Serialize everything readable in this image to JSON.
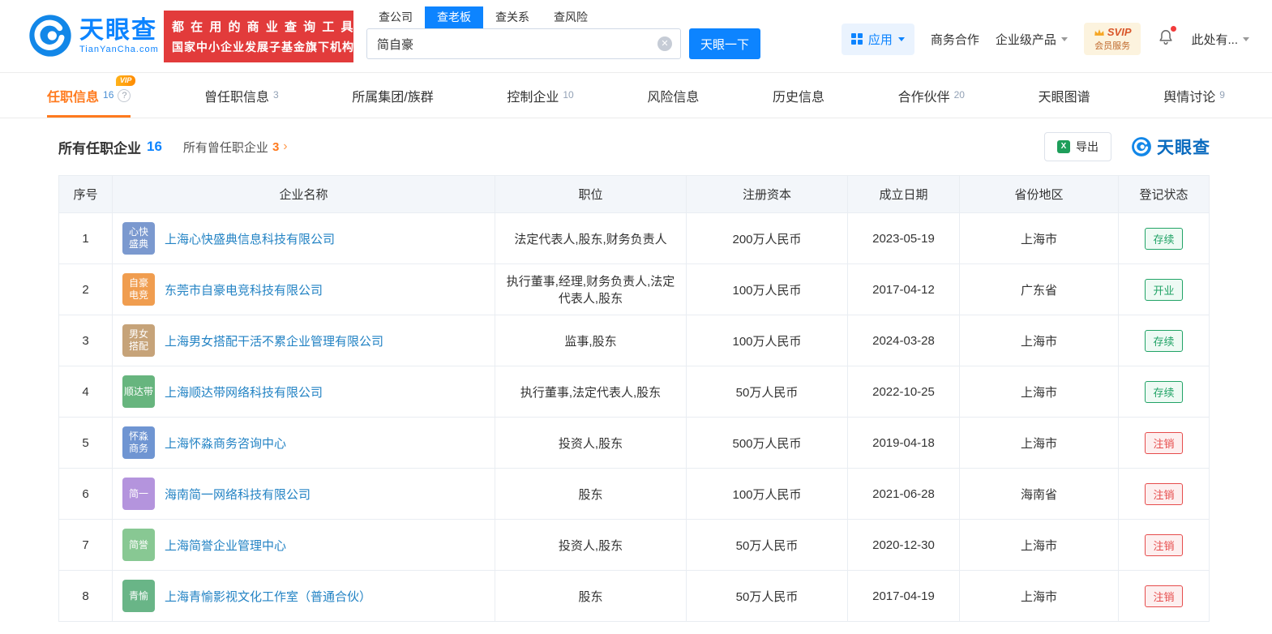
{
  "icons": {
    "help": "?",
    "clear": "✕",
    "chevron": "›",
    "excel": "X"
  },
  "header": {
    "logo": {
      "name": "天眼查",
      "domain": "TianYanCha.com"
    },
    "banner": {
      "line1": "都 在 用 的 商 业 查 询 工 具",
      "line2": "国家中小企业发展子基金旗下机构"
    },
    "search": {
      "tabs": [
        {
          "label": "查公司"
        },
        {
          "label": "查老板"
        },
        {
          "label": "查关系"
        },
        {
          "label": "查风险"
        }
      ],
      "value": "简自豪",
      "button": "天眼一下"
    },
    "nav": {
      "apps": "应用",
      "coop": "商务合作",
      "enterprise": "企业级产品",
      "svip_line1": "SVIP",
      "svip_line2": "会员服务",
      "user": "此处有..."
    }
  },
  "tabs": [
    {
      "label": "任职信息",
      "count": "16",
      "vip": "VIP"
    },
    {
      "label": "曾任职信息",
      "count": "3"
    },
    {
      "label": "所属集团/族群",
      "count": ""
    },
    {
      "label": "控制企业",
      "count": "10"
    },
    {
      "label": "风险信息",
      "count": ""
    },
    {
      "label": "历史信息",
      "count": ""
    },
    {
      "label": "合作伙伴",
      "count": "20"
    },
    {
      "label": "天眼图谱",
      "count": ""
    },
    {
      "label": "舆情讨论",
      "count": "9"
    }
  ],
  "section": {
    "title": "所有任职企业",
    "count": "16",
    "subtitle": "所有曾任职企业",
    "subcount": "3",
    "export_label": "导出",
    "brand": "天眼查"
  },
  "table": {
    "headers": [
      "序号",
      "企业名称",
      "职位",
      "注册资本",
      "成立日期",
      "省份地区",
      "登记状态"
    ],
    "rows": [
      {
        "seq": "1",
        "icon_line1": "心快",
        "icon_line2": "盛典",
        "icon_color": "#7b99cf",
        "name": "上海心快盛典信息科技有限公司",
        "position": "法定代表人,股东,财务负责人",
        "capital": "200万人民币",
        "date": "2023-05-19",
        "province": "上海市",
        "status": "存续",
        "status_color": "#21a366",
        "status_bg": "#eefaf4"
      },
      {
        "seq": "2",
        "icon_line1": "自豪",
        "icon_line2": "电竞",
        "icon_color": "#f09d4f",
        "name": "东莞市自豪电竞科技有限公司",
        "position": "执行董事,经理,财务负责人,法定代表人,股东",
        "capital": "100万人民币",
        "date": "2017-04-12",
        "province": "广东省",
        "status": "开业",
        "status_color": "#21a366",
        "status_bg": "#eefaf4"
      },
      {
        "seq": "3",
        "icon_line1": "男女",
        "icon_line2": "搭配",
        "icon_color": "#c6a379",
        "name": "上海男女搭配干活不累企业管理有限公司",
        "position": "监事,股东",
        "capital": "100万人民币",
        "date": "2024-03-28",
        "province": "上海市",
        "status": "存续",
        "status_color": "#21a366",
        "status_bg": "#eefaf4"
      },
      {
        "seq": "4",
        "icon_line1": "顺达带",
        "icon_line2": "",
        "icon_color": "#67b57e",
        "name": "上海顺达带网络科技有限公司",
        "position": "执行董事,法定代表人,股东",
        "capital": "50万人民币",
        "date": "2022-10-25",
        "province": "上海市",
        "status": "存续",
        "status_color": "#21a366",
        "status_bg": "#eefaf4"
      },
      {
        "seq": "5",
        "icon_line1": "怀淼",
        "icon_line2": "商务",
        "icon_color": "#6f95d2",
        "name": "上海怀淼商务咨询中心",
        "position": "投资人,股东",
        "capital": "500万人民币",
        "date": "2019-04-18",
        "province": "上海市",
        "status": "注销",
        "status_color": "#e64c4c",
        "status_bg": "#fdefef"
      },
      {
        "seq": "6",
        "icon_line1": "简一",
        "icon_line2": "",
        "icon_color": "#b494dd",
        "name": "海南简一网络科技有限公司",
        "position": "股东",
        "capital": "100万人民币",
        "date": "2021-06-28",
        "province": "海南省",
        "status": "注销",
        "status_color": "#e64c4c",
        "status_bg": "#fdefef"
      },
      {
        "seq": "7",
        "icon_line1": "简誉",
        "icon_line2": "",
        "icon_color": "#88c893",
        "name": "上海简誉企业管理中心",
        "position": "投资人,股东",
        "capital": "50万人民币",
        "date": "2020-12-30",
        "province": "上海市",
        "status": "注销",
        "status_color": "#e64c4c",
        "status_bg": "#fdefef"
      },
      {
        "seq": "8",
        "icon_line1": "青愉",
        "icon_line2": "",
        "icon_color": "#69b587",
        "name": "上海青愉影视文化工作室（普通合伙）",
        "position": "股东",
        "capital": "50万人民币",
        "date": "2017-04-19",
        "province": "上海市",
        "status": "注销",
        "status_color": "#e64c4c",
        "status_bg": "#fdefef"
      }
    ]
  }
}
